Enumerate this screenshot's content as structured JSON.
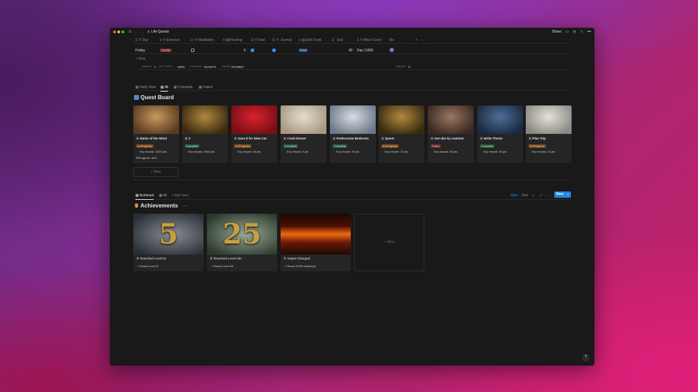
{
  "window": {
    "title": "Life Quests",
    "share": "Share"
  },
  "table": {
    "columns": [
      "Day",
      "Exercise",
      "Meditation",
      "Reading",
      "Fast",
      "Journal",
      "Junk Food",
      "Exp",
      "Alive Count",
      "Ba"
    ],
    "row": {
      "day": "Friday",
      "exercise": "Cardio",
      "meditation_checked": false,
      "reading": "0",
      "fast_checked": true,
      "journal_checked": true,
      "junk_food": "Free",
      "exp": "40",
      "alive_count": "Day 11691"
    },
    "new_label": "+ New",
    "footer": {
      "unique_label": "UNIQUE",
      "unique_val": "1",
      "notempty_label": "NOT EMPTY",
      "notempty_val": "100%",
      "checked_label": "CHECKED",
      "checked_val": "66.667%",
      "range_label": "RANGE",
      "range_val": "28.66667",
      "unique2_label": "UNIQUE",
      "unique2_val": "0"
    }
  },
  "quest_tabs": [
    "Daily View",
    "All",
    "Complete",
    "Failed"
  ],
  "quest_board": {
    "title": "Quest Board",
    "new_label": "+ New"
  },
  "quests": [
    {
      "name": "Name of the Wind",
      "status": "In-Progress",
      "reward": "Exp reward: 153.8 pts",
      "progress": "Progress: 46%",
      "colors": [
        "#5a3a20",
        "#c89a60"
      ]
    },
    {
      "name": "2",
      "status": "Complete",
      "reward": "Exp reward: 5000 pts",
      "colors": [
        "#3a2a10",
        "#b08a40"
      ]
    },
    {
      "name": "Save $ for New Car",
      "status": "In-Progress",
      "reward": "Exp reward: 50 pts",
      "colors": [
        "#7a0e14",
        "#d8222e"
      ]
    },
    {
      "name": "Cook Dinner",
      "status": "Complete",
      "reward": "Exp reward: 5 pts",
      "colors": [
        "#a89880",
        "#e6ddd0"
      ]
    },
    {
      "name": "Redecorate Bedroom",
      "status": "Complete",
      "reward": "Exp reward: 20 pts",
      "colors": [
        "#6c7a88",
        "#d8dde2"
      ]
    },
    {
      "name": "Quest",
      "status": "In-Progress",
      "reward": "Exp reward: 10 pts",
      "colors": [
        "#3a2a10",
        "#b08a40"
      ]
    },
    {
      "name": "Get abs by summer",
      "status": "Failed",
      "reward": "Exp reward: 50 pts",
      "colors": [
        "#3a2a22",
        "#9a7660"
      ]
    },
    {
      "name": "Write Thesis",
      "status": "Complete",
      "reward": "Exp reward: 50 pts",
      "colors": [
        "#1a2a40",
        "#4e6e96"
      ]
    },
    {
      "name": "Plan Trip",
      "status": "In-Progress",
      "reward": "Exp reward: 15 pts",
      "colors": [
        "#8a8a84",
        "#e6e2da"
      ]
    }
  ],
  "ach_tabs": [
    "Achieved",
    "All",
    "+ Add view"
  ],
  "ach_toolbar": {
    "filter": "Filter",
    "sort": "Sort",
    "new": "New"
  },
  "achievements_title": "Achievements",
  "achievements": [
    {
      "name": "Reached Level 5!",
      "desc": "> Reach Level 5!",
      "big": "5",
      "colors": [
        "#2a3038",
        "#8a8e92"
      ]
    },
    {
      "name": "Reached Level 25!",
      "desc": "> Reach Level 25!",
      "big": "25",
      "colors": [
        "#2c3a2c",
        "#9aa89a"
      ]
    },
    {
      "name": "Super-Charged",
      "desc": "> Reach 200% efficiency!",
      "big": "",
      "colors": [
        "#4a0e04",
        "#f06a10"
      ]
    }
  ],
  "ach_new_label": "+ New",
  "colors": {
    "accent": "#2383e2",
    "complete": "#2b593f",
    "progress": "#7a4a1e",
    "failed": "#6e2b2b"
  }
}
